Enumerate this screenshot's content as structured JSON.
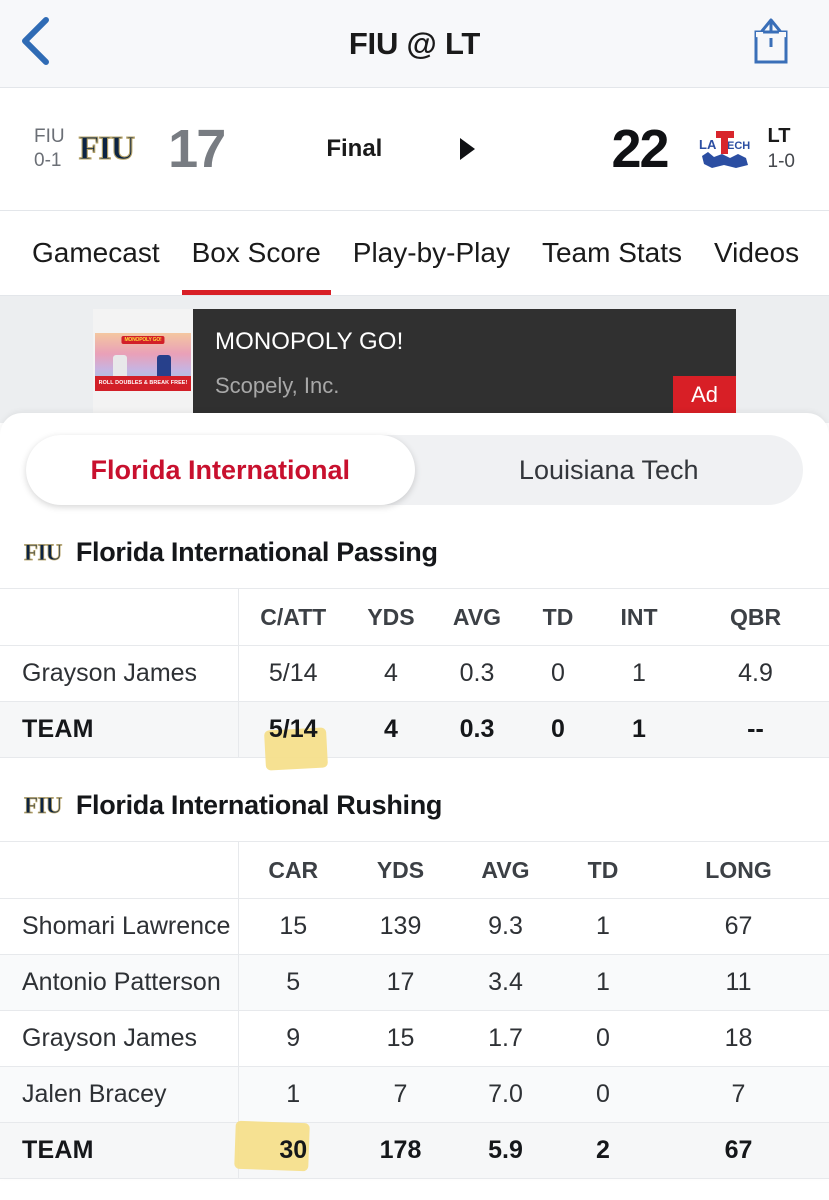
{
  "navbar": {
    "title": "FIU @ LT",
    "back_icon": "chevron-left-icon",
    "share_icon": "share-icon"
  },
  "scoreboard": {
    "away": {
      "abbr": "FIU",
      "record": "0-1",
      "score": "17",
      "logo": "fiu-logo",
      "logo_text": "FIU"
    },
    "home": {
      "abbr": "LT",
      "record": "1-0",
      "score": "22",
      "logo": "latech-logo"
    },
    "status": "Final",
    "winner_indicator": "right-triangle-icon"
  },
  "tabs": [
    {
      "label": "Gamecast",
      "active": false
    },
    {
      "label": "Box Score",
      "active": true
    },
    {
      "label": "Play-by-Play",
      "active": false
    },
    {
      "label": "Team Stats",
      "active": false
    },
    {
      "label": "Videos",
      "active": false
    }
  ],
  "ad": {
    "title": "MONOPOLY GO!",
    "advertiser": "Scopely, Inc.",
    "badge": "Ad",
    "thumb_brand": "MONOPOLY GO!",
    "thumb_caption": "ROLL DOUBLES & BREAK FREE!"
  },
  "team_switcher": {
    "options": [
      {
        "label": "Florida International",
        "active": true
      },
      {
        "label": "Louisiana Tech",
        "active": false
      }
    ]
  },
  "sections": [
    {
      "logo_text": "FIU",
      "title": "Florida International Passing",
      "columns": [
        "",
        "C/ATT",
        "YDS",
        "AVG",
        "TD",
        "INT",
        "QBR"
      ],
      "rows": [
        {
          "name": "Grayson James",
          "type": "player",
          "values": [
            "5/14",
            "4",
            "0.3",
            "0",
            "1",
            "4.9"
          ]
        },
        {
          "name": "TEAM",
          "type": "team",
          "values": [
            "5/14",
            "4",
            "0.3",
            "0",
            "1",
            "--"
          ],
          "highlight_index": 0
        }
      ]
    },
    {
      "logo_text": "FIU",
      "title": "Florida International Rushing",
      "columns": [
        "",
        "CAR",
        "YDS",
        "AVG",
        "TD",
        "LONG"
      ],
      "rows": [
        {
          "name": "Shomari Lawrence",
          "type": "player",
          "values": [
            "15",
            "139",
            "9.3",
            "1",
            "67"
          ]
        },
        {
          "name": "Antonio Patterson",
          "type": "player",
          "values": [
            "5",
            "17",
            "3.4",
            "1",
            "11"
          ]
        },
        {
          "name": "Grayson James",
          "type": "player",
          "values": [
            "9",
            "15",
            "1.7",
            "0",
            "18"
          ]
        },
        {
          "name": "Jalen Bracey",
          "type": "player",
          "values": [
            "1",
            "7",
            "7.0",
            "0",
            "7"
          ]
        },
        {
          "name": "TEAM",
          "type": "team",
          "values": [
            "30",
            "178",
            "5.9",
            "2",
            "67"
          ],
          "highlight_index": 0
        }
      ]
    }
  ],
  "colors": {
    "accent_red": "#d81f26",
    "active_team_red": "#c8102e",
    "link_blue": "#3a6fb8",
    "fiu_navy": "#0b2343",
    "fiu_gold": "#b6a369",
    "highlighter": "#f5df8c"
  }
}
